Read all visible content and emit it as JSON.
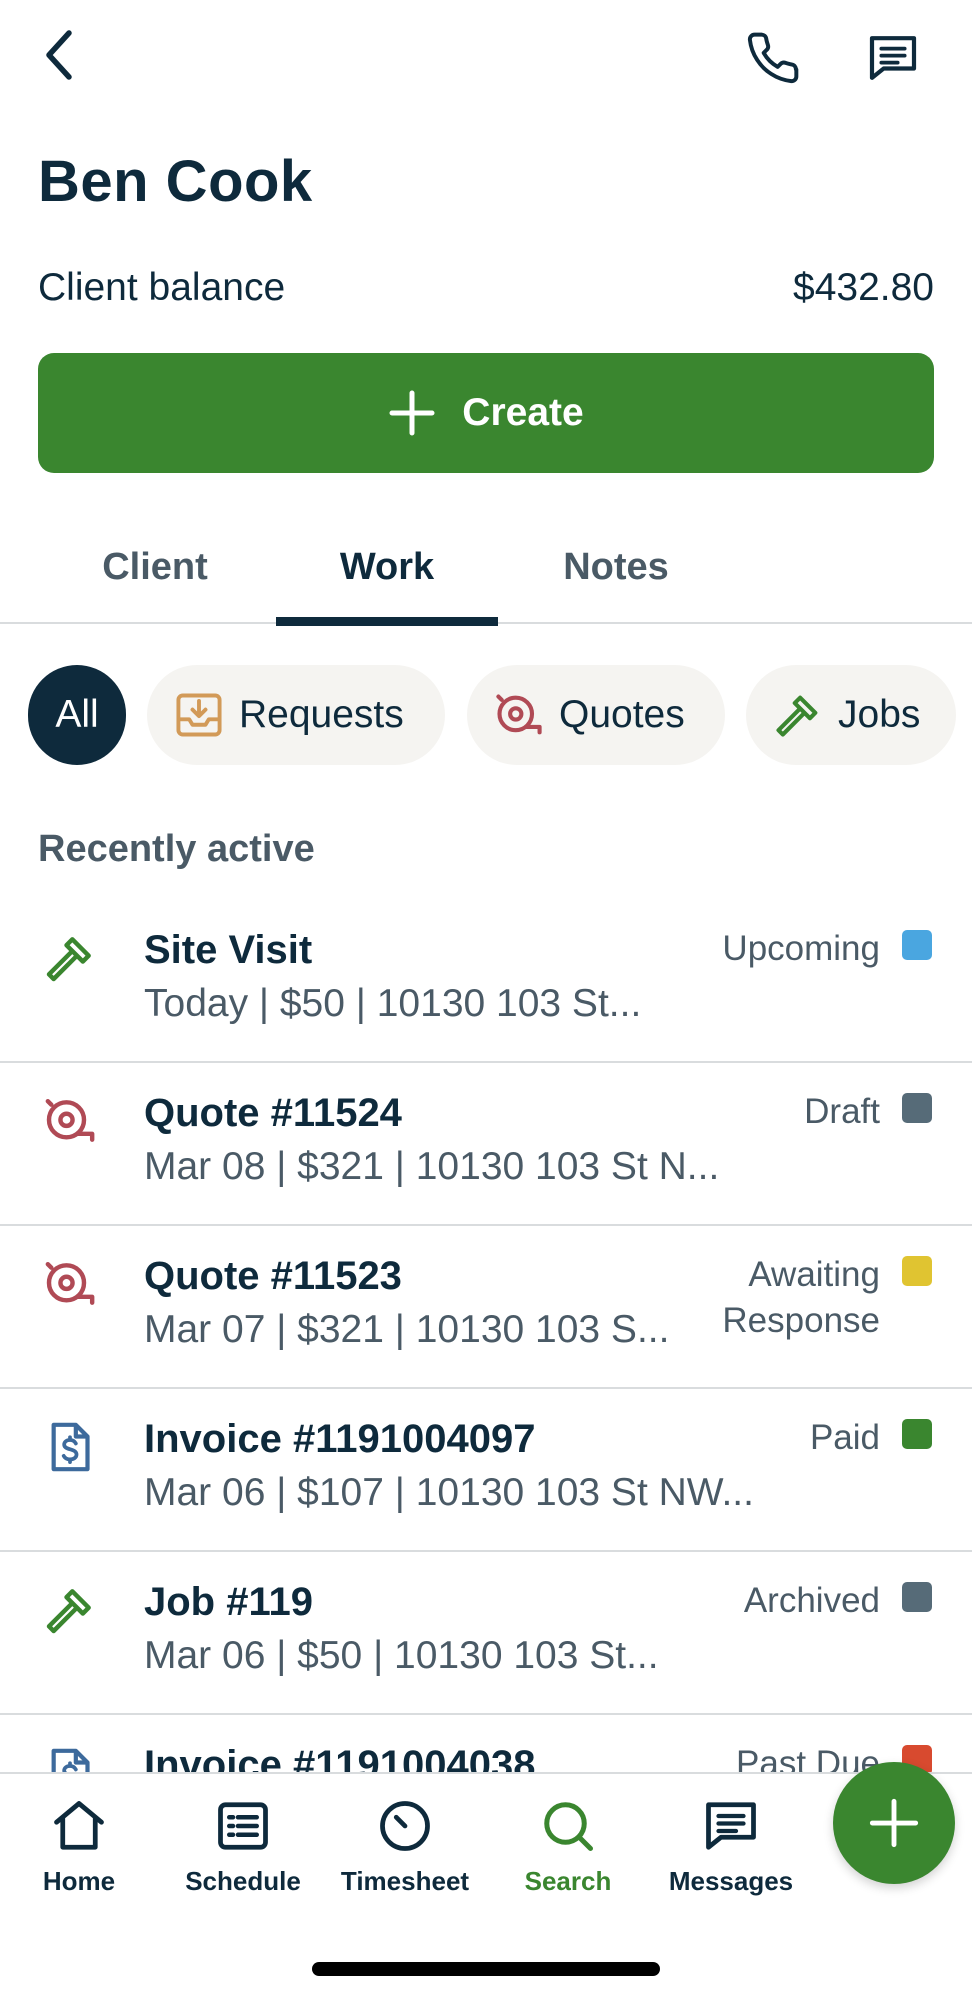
{
  "header": {
    "client_name": "Ben Cook",
    "balance_label": "Client balance",
    "balance_value": "$432.80"
  },
  "create_button": {
    "label": "Create"
  },
  "tabs": [
    {
      "label": "Client",
      "active": false
    },
    {
      "label": "Work",
      "active": true
    },
    {
      "label": "Notes",
      "active": false
    }
  ],
  "filters": [
    {
      "label": "All",
      "active": true,
      "icon": "none"
    },
    {
      "label": "Requests",
      "active": false,
      "icon": "inbox-download-icon",
      "color": "#d29a58"
    },
    {
      "label": "Quotes",
      "active": false,
      "icon": "measuring-tape-icon",
      "color": "#b04a55"
    },
    {
      "label": "Jobs",
      "active": false,
      "icon": "hammer-icon",
      "color": "#3a862f"
    }
  ],
  "section": {
    "title": "Recently active"
  },
  "items": [
    {
      "title": "Site Visit",
      "subtitle": "Today | $50 | 10130 103 St...",
      "status": "Upcoming",
      "status_line2": "",
      "status_color": "#4aa6e0",
      "icon": "hammer-icon"
    },
    {
      "title": "Quote #11524",
      "subtitle": "Mar 08 | $321 | 10130 103 St N...",
      "status": "Draft",
      "status_line2": "",
      "status_color": "#566b78",
      "icon": "measuring-tape-icon"
    },
    {
      "title": "Quote #11523",
      "subtitle": "Mar 07 | $321 | 10130 103 S...",
      "status": "Awaiting",
      "status_line2": "Response",
      "status_color": "#e0c431",
      "icon": "measuring-tape-icon"
    },
    {
      "title": "Invoice #1191004097",
      "subtitle": "Mar 06 | $107 | 10130 103 St NW...",
      "status": "Paid",
      "status_line2": "",
      "status_color": "#3a862f",
      "icon": "invoice-dollar-icon"
    },
    {
      "title": "Job #119",
      "subtitle": "Mar 06 | $50 | 10130 103 St...",
      "status": "Archived",
      "status_line2": "",
      "status_color": "#566b78",
      "icon": "hammer-icon"
    },
    {
      "title": "Invoice #1191004038",
      "subtitle": "",
      "status": "Past Due",
      "status_line2": "",
      "status_color": "#d84a2f",
      "icon": "invoice-dollar-icon"
    }
  ],
  "nav": [
    {
      "label": "Home",
      "icon": "home-icon",
      "active": false
    },
    {
      "label": "Schedule",
      "icon": "schedule-list-icon",
      "active": false
    },
    {
      "label": "Timesheet",
      "icon": "clock-icon",
      "active": false
    },
    {
      "label": "Search",
      "icon": "search-icon",
      "active": true
    },
    {
      "label": "Messages",
      "icon": "message-icon",
      "active": false
    }
  ],
  "colors": {
    "brand_green": "#3a862f",
    "navy": "#0e2a3c",
    "muted": "#4a5a66"
  }
}
